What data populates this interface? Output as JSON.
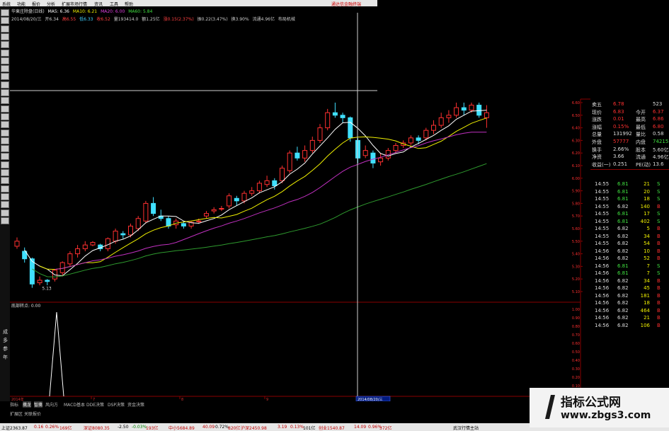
{
  "menu": {
    "items": [
      "系统",
      "功能",
      "报价",
      "分析",
      "扩展市场行情",
      "资讯",
      "工具",
      "帮助"
    ],
    "tag": "通达信金融终端"
  },
  "header": {
    "stock_line": [
      "华東庄除盘(日线)",
      "MA5: 6.36",
      "MA10: 6.21",
      "MA20: 6.00",
      "MA60: 5.84"
    ],
    "info_line": [
      "2014/08/20/三",
      "开6.34",
      "高6.55",
      "低6.33",
      "收6.52",
      "量193414.0",
      "额1.25亿",
      "涨0.15(2.37%)",
      "振0.22(3.47%)",
      "换3.90%",
      "流通4.96亿",
      "布局机械"
    ]
  },
  "left_toolbar": {
    "labels": [
      "成",
      "多",
      "参",
      "年"
    ]
  },
  "chart_data": {
    "type": "candlestick",
    "low_label": "5.13",
    "crosshair_date": "2014/08/20/三",
    "x_start_label": "2014年",
    "x_mid_labels": [
      "7",
      "8",
      "9"
    ],
    "price_axis": [
      "6.60",
      "6.50",
      "6.40",
      "6.30",
      "6.20",
      "6.10",
      "6.00",
      "5.90",
      "5.80",
      "5.70",
      "5.60",
      "5.50",
      "5.40",
      "5.30",
      "5.20",
      "5.10"
    ],
    "indicator_axis": [
      "1.00",
      "0.90",
      "0.80",
      "0.70",
      "0.60",
      "0.50",
      "0.40",
      "0.30",
      "0.20",
      "0.10",
      "0.00"
    ],
    "indicator_label": "底部转点",
    "indicator_value": "底部转点: 0.00",
    "candles": [
      {
        "o": 5.46,
        "c": 5.5,
        "h": 5.53,
        "l": 5.44
      },
      {
        "o": 5.42,
        "c": 5.36,
        "h": 5.45,
        "l": 5.33
      },
      {
        "o": 5.36,
        "c": 5.16,
        "h": 5.37,
        "l": 5.13
      },
      {
        "o": 5.17,
        "c": 5.19,
        "h": 5.22,
        "l": 5.15
      },
      {
        "o": 5.19,
        "c": 5.18,
        "h": 5.2,
        "l": 5.15
      },
      {
        "o": 5.2,
        "c": 5.27,
        "h": 5.28,
        "l": 5.18
      },
      {
        "o": 5.25,
        "c": 5.33,
        "h": 5.34,
        "l": 5.22
      },
      {
        "o": 5.32,
        "c": 5.4,
        "h": 5.42,
        "l": 5.3
      },
      {
        "o": 5.4,
        "c": 5.44,
        "h": 5.47,
        "l": 5.37
      },
      {
        "o": 5.44,
        "c": 5.47,
        "h": 5.5,
        "l": 5.42
      },
      {
        "o": 5.47,
        "c": 5.49,
        "h": 5.5,
        "l": 5.46
      },
      {
        "o": 5.47,
        "c": 5.44,
        "h": 5.48,
        "l": 5.42
      },
      {
        "o": 5.44,
        "c": 5.52,
        "h": 5.53,
        "l": 5.42
      },
      {
        "o": 5.5,
        "c": 5.58,
        "h": 5.6,
        "l": 5.48
      },
      {
        "o": 5.56,
        "c": 5.55,
        "h": 5.58,
        "l": 5.52
      },
      {
        "o": 5.55,
        "c": 5.62,
        "h": 5.64,
        "l": 5.53
      },
      {
        "o": 5.6,
        "c": 5.68,
        "h": 5.7,
        "l": 5.58
      },
      {
        "o": 5.66,
        "c": 5.8,
        "h": 5.82,
        "l": 5.64
      },
      {
        "o": 5.8,
        "c": 5.72,
        "h": 5.85,
        "l": 5.7
      },
      {
        "o": 5.7,
        "c": 5.68,
        "h": 5.75,
        "l": 5.66
      },
      {
        "o": 5.68,
        "c": 5.62,
        "h": 5.7,
        "l": 5.6
      },
      {
        "o": 5.63,
        "c": 5.66,
        "h": 5.68,
        "l": 5.6
      },
      {
        "o": 5.64,
        "c": 5.62,
        "h": 5.66,
        "l": 5.6
      },
      {
        "o": 5.62,
        "c": 5.65,
        "h": 5.66,
        "l": 5.6
      },
      {
        "o": 5.66,
        "c": 5.66,
        "h": 5.68,
        "l": 5.64
      },
      {
        "o": 5.7,
        "c": 5.72,
        "h": 5.74,
        "l": 5.68
      },
      {
        "o": 5.74,
        "c": 5.75,
        "h": 5.77,
        "l": 5.72
      },
      {
        "o": 5.76,
        "c": 5.76,
        "h": 5.78,
        "l": 5.74
      },
      {
        "o": 5.78,
        "c": 5.86,
        "h": 5.88,
        "l": 5.76
      },
      {
        "o": 5.84,
        "c": 5.82,
        "h": 5.86,
        "l": 5.78
      },
      {
        "o": 5.82,
        "c": 5.88,
        "h": 5.9,
        "l": 5.8
      },
      {
        "o": 5.88,
        "c": 5.9,
        "h": 5.93,
        "l": 5.86
      },
      {
        "o": 5.9,
        "c": 5.96,
        "h": 5.98,
        "l": 5.88
      },
      {
        "o": 5.95,
        "c": 5.98,
        "h": 6.02,
        "l": 5.93
      },
      {
        "o": 5.98,
        "c": 5.94,
        "h": 6.0,
        "l": 5.91
      },
      {
        "o": 5.98,
        "c": 6.08,
        "h": 6.1,
        "l": 5.96
      },
      {
        "o": 6.06,
        "c": 6.2,
        "h": 6.22,
        "l": 6.04
      },
      {
        "o": 6.2,
        "c": 6.16,
        "h": 6.25,
        "l": 6.14
      },
      {
        "o": 6.16,
        "c": 6.22,
        "h": 6.26,
        "l": 6.13
      },
      {
        "o": 6.22,
        "c": 6.3,
        "h": 6.33,
        "l": 6.2
      },
      {
        "o": 6.3,
        "c": 6.4,
        "h": 6.43,
        "l": 6.28
      },
      {
        "o": 6.4,
        "c": 6.52,
        "h": 6.55,
        "l": 6.38
      },
      {
        "o": 6.52,
        "c": 6.5,
        "h": 6.6,
        "l": 6.48
      },
      {
        "o": 6.5,
        "c": 6.48,
        "h": 6.52,
        "l": 6.44
      },
      {
        "o": 6.48,
        "c": 6.32,
        "h": 6.49,
        "l": 6.29
      },
      {
        "o": 6.3,
        "c": 6.16,
        "h": 6.32,
        "l": 6.12
      },
      {
        "o": 6.18,
        "c": 6.22,
        "h": 6.26,
        "l": 6.16
      },
      {
        "o": 6.2,
        "c": 6.12,
        "h": 6.22,
        "l": 6.08
      },
      {
        "o": 6.13,
        "c": 6.16,
        "h": 6.2,
        "l": 6.1
      },
      {
        "o": 6.16,
        "c": 6.22,
        "h": 6.24,
        "l": 6.14
      },
      {
        "o": 6.22,
        "c": 6.26,
        "h": 6.28,
        "l": 6.2
      },
      {
        "o": 6.26,
        "c": 6.28,
        "h": 6.3,
        "l": 6.24
      },
      {
        "o": 6.28,
        "c": 6.32,
        "h": 6.34,
        "l": 6.26
      },
      {
        "o": 6.32,
        "c": 6.3,
        "h": 6.34,
        "l": 6.27
      },
      {
        "o": 6.32,
        "c": 6.38,
        "h": 6.4,
        "l": 6.3
      },
      {
        "o": 6.38,
        "c": 6.42,
        "h": 6.46,
        "l": 6.35
      },
      {
        "o": 6.42,
        "c": 6.48,
        "h": 6.52,
        "l": 6.4
      },
      {
        "o": 6.48,
        "c": 6.5,
        "h": 6.54,
        "l": 6.44
      },
      {
        "o": 6.5,
        "c": 6.56,
        "h": 6.6,
        "l": 6.48
      },
      {
        "o": 6.56,
        "c": 6.54,
        "h": 6.6,
        "l": 6.5
      },
      {
        "o": 6.54,
        "c": 6.58,
        "h": 6.6,
        "l": 6.52
      },
      {
        "o": 6.58,
        "c": 6.5,
        "h": 6.6,
        "l": 6.48
      },
      {
        "o": 6.48,
        "c": 6.52,
        "h": 6.58,
        "l": 6.4
      }
    ]
  },
  "quote": {
    "rows": [
      [
        "卖五",
        "6.78",
        "",
        "523"
      ],
      [
        "现价",
        "6.83",
        "今开",
        "6.37"
      ],
      [
        "涨跌",
        "0.01",
        "最高",
        "6.86"
      ],
      [
        "涨幅",
        "0.15%",
        "最低",
        "6.80"
      ],
      [
        "总量",
        "131992",
        "量比",
        "0.58"
      ],
      [
        "外盘",
        "57777",
        "内盘",
        "74215"
      ],
      [
        "换手",
        "2.66%",
        "股本",
        "5.60亿"
      ],
      [
        "净资",
        "3.66",
        "流通",
        "4.96亿"
      ],
      [
        "收益(一)",
        "0.251",
        "PE(动)",
        "13.6"
      ]
    ],
    "ticks": [
      [
        "14:55",
        "6.81",
        "21",
        "S"
      ],
      [
        "14:55",
        "6.81",
        "20",
        "S"
      ],
      [
        "14:55",
        "6.81",
        "18",
        "S"
      ],
      [
        "14:55",
        "6.82",
        "140",
        "B"
      ],
      [
        "14:55",
        "6.81",
        "17",
        "S"
      ],
      [
        "14:55",
        "6.81",
        "402",
        "S"
      ],
      [
        "14:55",
        "6.82",
        "5",
        "B"
      ],
      [
        "14:55",
        "6.82",
        "34",
        "B"
      ],
      [
        "14:55",
        "6.82",
        "54",
        "B"
      ],
      [
        "14:56",
        "6.82",
        "10",
        "B"
      ],
      [
        "14:56",
        "6.82",
        "52",
        "B"
      ],
      [
        "14:56",
        "6.81",
        "7",
        "S"
      ],
      [
        "14:56",
        "6.81",
        "7",
        "S"
      ],
      [
        "14:56",
        "6.82",
        "34",
        "B"
      ],
      [
        "14:56",
        "6.82",
        "45",
        "B"
      ],
      [
        "14:56",
        "6.82",
        "181",
        "B"
      ],
      [
        "14:56",
        "6.82",
        "18",
        "B"
      ],
      [
        "14:56",
        "6.82",
        "464",
        "B"
      ],
      [
        "14:56",
        "6.82",
        "21",
        "B"
      ],
      [
        "14:56",
        "6.82",
        "106",
        "B"
      ]
    ]
  },
  "bottom": {
    "tabs": [
      "指标",
      "擒龙",
      "智擒",
      "风向方",
      "MACD基本",
      "DDE决策",
      "DSP决策",
      "资金决策"
    ],
    "sub_tabs": [
      "扩展区",
      "关联报价"
    ],
    "status": [
      "上证2363.87",
      "0.16",
      "0.26%",
      "169亿",
      "深证8080.35",
      "-2.50",
      "-0.03%",
      "193亿",
      "中小5684.89",
      "40.09",
      "0.72%",
      "820亿",
      "沪深2450.98",
      "3.19",
      "0.13%",
      "101亿",
      "创业1540.87",
      "14.09",
      "0.96%",
      "372亿",
      "武汉行情主站"
    ]
  },
  "watermark": {
    "title": "指标公式网",
    "url": "www.zbgs3.com"
  }
}
